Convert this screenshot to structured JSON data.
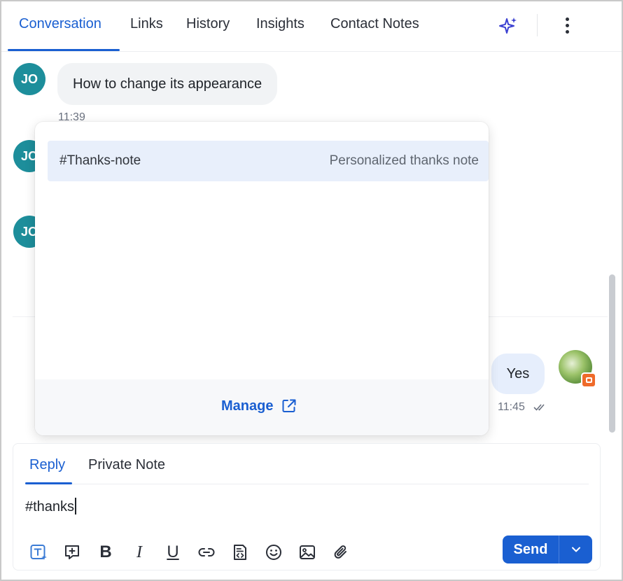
{
  "tabs": [
    {
      "label": "Conversation",
      "active": true
    },
    {
      "label": "Links"
    },
    {
      "label": "History"
    },
    {
      "label": "Insights"
    },
    {
      "label": "Contact Notes"
    }
  ],
  "icons": {
    "ai_assist": "sparkle-icon",
    "more": "kebab-menu-icon",
    "external": "external-link-icon",
    "channel": "chat-channel-icon"
  },
  "conversation": {
    "avatar_initials": "JO",
    "incoming": {
      "text": "How to change its appearance",
      "time": "11:39"
    },
    "outgoing": {
      "text": "Yes",
      "time": "11:45"
    }
  },
  "suggestions": {
    "items": [
      {
        "key": "#Thanks-note",
        "description": "Personalized thanks note"
      }
    ],
    "manage_label": "Manage"
  },
  "composer": {
    "tabs": [
      {
        "label": "Reply",
        "active": true
      },
      {
        "label": "Private Note"
      }
    ],
    "value": "#thanks",
    "toolbar": [
      "templates",
      "insert-snippet",
      "bold",
      "italic",
      "underline",
      "link",
      "code-block",
      "emoji",
      "image",
      "attachment"
    ],
    "bold_glyph": "B",
    "italic_glyph": "I",
    "underline_glyph": "U",
    "send_label": "Send"
  },
  "colors": {
    "accent": "#1a5fd1",
    "avatar_bg": "#1d8e9b",
    "channel_badge": "#ef6a2a",
    "highlight": "#e8effb"
  }
}
